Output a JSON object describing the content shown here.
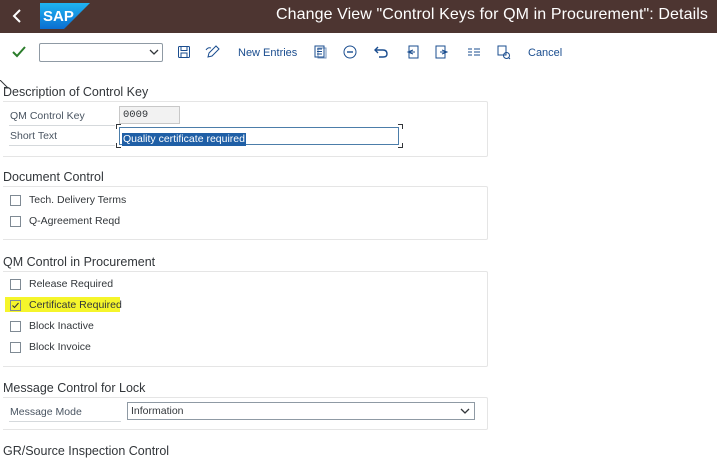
{
  "header": {
    "logo_text": "SAP",
    "title": "Change View \"Control Keys for QM in Procurement\": Details",
    "bar_color": "#4d3531",
    "icons": [
      "back-arrow-icon",
      "sap-logo"
    ]
  },
  "toolbar": {
    "command_field_value": "",
    "new_entries_label": "New Entries",
    "cancel_label": "Cancel",
    "icons": [
      "check-icon",
      "save-icon",
      "display-change-icon",
      "copy-as-icon",
      "delete-icon",
      "undo-icon",
      "previous-entry-icon",
      "next-entry-icon",
      "select-all-icon",
      "print-icon"
    ]
  },
  "description": {
    "section_title": "Description of Control Key",
    "qm_control_key_label": "QM Control Key",
    "qm_control_key_value": "0009",
    "short_text_label": "Short Text",
    "short_text_value": "Quality certificate required"
  },
  "document_control": {
    "section_title": "Document Control",
    "items": [
      {
        "label": "Tech. Delivery Terms",
        "checked": false
      },
      {
        "label": "Q-Agreement Reqd",
        "checked": false
      }
    ]
  },
  "qm_control": {
    "section_title": "QM Control in Procurement",
    "items": [
      {
        "label": "Release Required",
        "checked": false
      },
      {
        "label": "Certificate Required",
        "checked": true,
        "highlighted": true
      },
      {
        "label": "Block Inactive",
        "checked": false
      },
      {
        "label": "Block Invoice",
        "checked": false
      }
    ],
    "highlight_color": "#f5f52b"
  },
  "message_control": {
    "section_title": "Message Control for Lock",
    "message_mode_label": "Message Mode",
    "message_mode_value": "Information"
  },
  "gr_source": {
    "section_title": "GR/Source Inspection Control"
  },
  "colors": {
    "link_blue": "#1a4d8f",
    "check_green": "#2b7d2b",
    "selection_blue": "#1f5fa6"
  }
}
